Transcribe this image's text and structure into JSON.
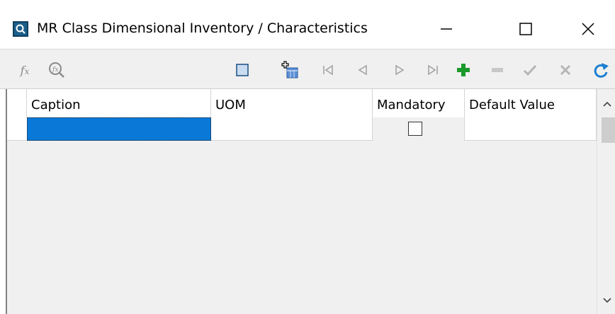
{
  "window": {
    "title": "MR Class Dimensional Inventory / Characteristics",
    "icon": "app-search-icon"
  },
  "toolbar": {
    "buttons": [
      {
        "name": "function-icon",
        "glyph": "fx"
      },
      {
        "name": "formula-search-icon"
      },
      {
        "name": "square-icon"
      },
      {
        "name": "add-calendar-icon"
      },
      {
        "name": "first-record-icon"
      },
      {
        "name": "previous-record-icon"
      },
      {
        "name": "next-record-icon"
      },
      {
        "name": "last-record-icon"
      },
      {
        "name": "add-record-icon"
      },
      {
        "name": "delete-record-icon"
      },
      {
        "name": "post-edit-icon"
      },
      {
        "name": "cancel-edit-icon"
      },
      {
        "name": "refresh-icon"
      }
    ]
  },
  "grid": {
    "columns": [
      {
        "key": "caption",
        "label": "Caption"
      },
      {
        "key": "uom",
        "label": "UOM"
      },
      {
        "key": "mandatory",
        "label": "Mandatory"
      },
      {
        "key": "default_value",
        "label": "Default Value"
      }
    ],
    "rows": [
      {
        "caption": "",
        "uom": "",
        "mandatory": false,
        "default_value": ""
      }
    ]
  },
  "colors": {
    "selection": "#0a78d7",
    "add": "#1a9a2a",
    "refresh": "#1d7fd1"
  }
}
